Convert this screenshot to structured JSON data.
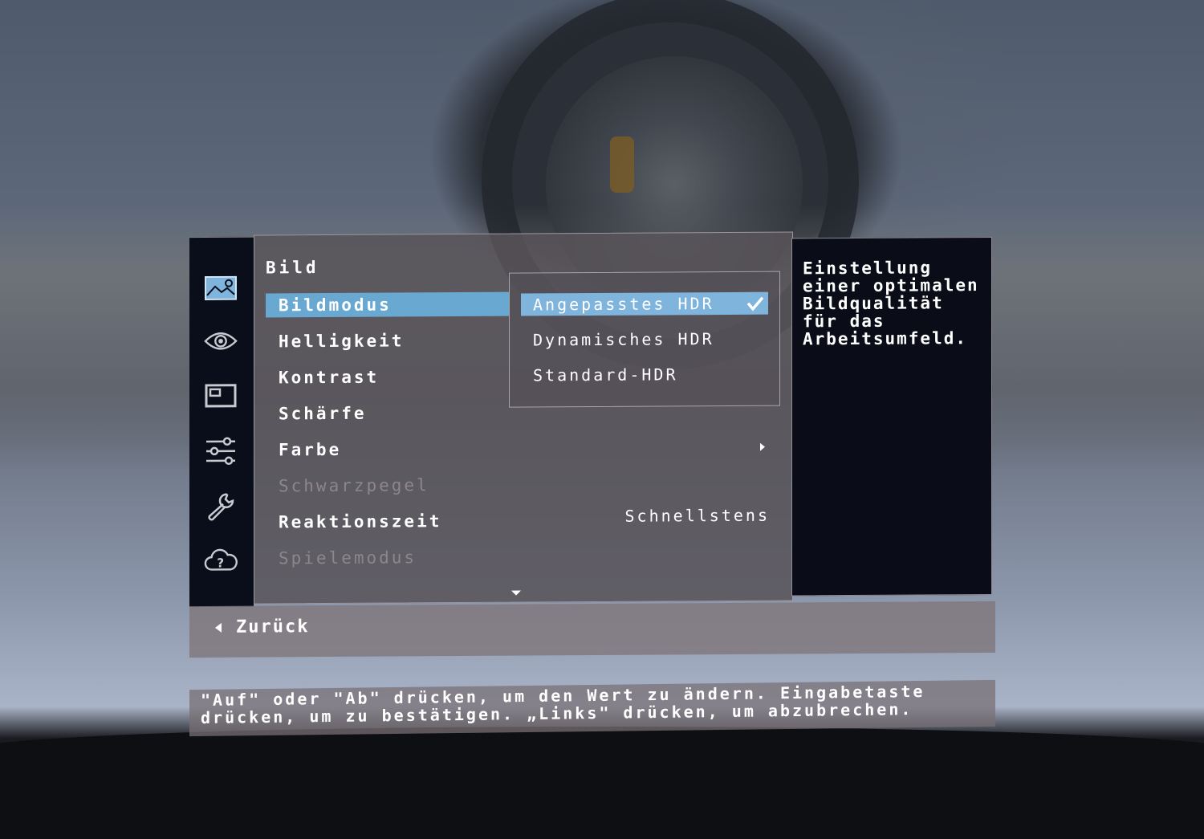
{
  "sidebar": {
    "icons": [
      {
        "name": "picture-icon",
        "active": true
      },
      {
        "name": "eye-icon",
        "active": false
      },
      {
        "name": "display-icon",
        "active": false
      },
      {
        "name": "sliders-icon",
        "active": false
      },
      {
        "name": "wrench-icon",
        "active": false
      },
      {
        "name": "help-cloud-icon",
        "active": false
      }
    ]
  },
  "menu": {
    "title": "Bild",
    "items": [
      {
        "label": "Bildmodus",
        "state": "selected"
      },
      {
        "label": "Helligkeit",
        "state": "normal"
      },
      {
        "label": "Kontrast",
        "state": "normal"
      },
      {
        "label": "Schärfe",
        "state": "normal"
      },
      {
        "label": "Farbe",
        "state": "normal",
        "has_submenu": true
      },
      {
        "label": "Schwarzpegel",
        "state": "disabled"
      },
      {
        "label": "Reaktionszeit",
        "state": "normal",
        "value": "Schnellstens"
      },
      {
        "label": "Spielemodus",
        "state": "disabled"
      }
    ]
  },
  "submenu": {
    "options": [
      {
        "label": "Angepasstes HDR",
        "selected": true
      },
      {
        "label": "Dynamisches HDR",
        "selected": false
      },
      {
        "label": "Standard-HDR",
        "selected": false
      }
    ]
  },
  "description": "Einstellung\neiner optimalen\nBildqualität\nfür das\nArbeitsumfeld.",
  "back_label": "Zurück",
  "hint": "\"Auf\" oder \"Ab\" drücken, um den Wert zu ändern. Eingabetaste\ndrücken, um zu bestätigen. „Links\" drücken, um abzubrechen.",
  "colors": {
    "selected_item": "#69a8d1",
    "selected_option": "#7fb4dc",
    "sidebar_bg": "#0a0d1a",
    "desc_bg": "#0a0c18"
  }
}
